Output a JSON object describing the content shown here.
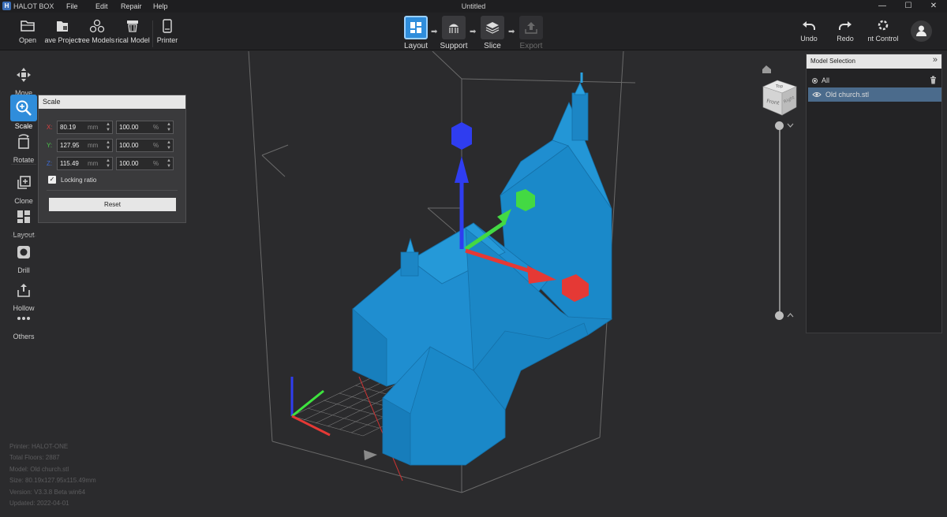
{
  "app": {
    "name": "HALOT BOX",
    "logo": "H",
    "document_title": "Untitled"
  },
  "menu": [
    "File",
    "Edit",
    "Repair",
    "Help"
  ],
  "window_controls": {
    "minimize": "—",
    "maximize": "☐",
    "close": "✕"
  },
  "toolbar_left": [
    {
      "label": "Open",
      "icon": "folder-open-icon"
    },
    {
      "label": "ave Project",
      "icon": "save-project-icon"
    },
    {
      "label": "ree Models",
      "icon": "free-models-icon"
    },
    {
      "label": "rical Model",
      "icon": "historical-model-icon"
    },
    {
      "label": "Printer",
      "icon": "printer-icon"
    }
  ],
  "steps": [
    {
      "label": "Layout",
      "state": "active",
      "icon": "layout-icon"
    },
    {
      "label": "Support",
      "state": "normal",
      "icon": "support-icon"
    },
    {
      "label": "Slice",
      "state": "normal",
      "icon": "slice-icon"
    },
    {
      "label": "Export",
      "state": "disabled",
      "icon": "export-icon"
    }
  ],
  "toolbar_right": [
    {
      "label": "Undo",
      "icon": "undo-icon"
    },
    {
      "label": "Redo",
      "icon": "redo-icon"
    },
    {
      "label": "nt Control",
      "icon": "print-control-icon"
    }
  ],
  "sidebar": [
    {
      "label": "Move",
      "icon": "move-icon",
      "active": false
    },
    {
      "label": "Scale",
      "icon": "scale-icon",
      "active": true
    },
    {
      "label": "Rotate",
      "icon": "rotate-icon",
      "active": false
    },
    {
      "label": "Clone",
      "icon": "clone-icon",
      "active": false
    },
    {
      "label": "Layout",
      "icon": "layout-icon",
      "active": false
    },
    {
      "label": "Drill",
      "icon": "drill-icon",
      "active": false
    },
    {
      "label": "Hollow",
      "icon": "hollow-icon",
      "active": false
    },
    {
      "label": "Others",
      "icon": "more-icon",
      "active": false
    }
  ],
  "scale_panel": {
    "title": "Scale",
    "rows": [
      {
        "axis": "X:",
        "value": "80.19",
        "unit": "mm",
        "percent": "100.00",
        "percent_unit": "%",
        "color": "#d94040"
      },
      {
        "axis": "Y:",
        "value": "127.95",
        "unit": "mm",
        "percent": "100.00",
        "percent_unit": "%",
        "color": "#49c44a"
      },
      {
        "axis": "Z:",
        "value": "115.49",
        "unit": "mm",
        "percent": "100.00",
        "percent_unit": "%",
        "color": "#3b6bd6"
      }
    ],
    "locking_ratio_label": "Locking ratio",
    "locking_ratio_checked": true,
    "reset_label": "Reset"
  },
  "model_selection": {
    "title": "Model Selection",
    "items": [
      {
        "label": "All",
        "selected": false
      },
      {
        "label": "Old church.stl",
        "selected": true
      }
    ]
  },
  "view_cube": {
    "top": "Top",
    "front": "Front",
    "right": "Right"
  },
  "info": [
    "Printer: HALOT-ONE",
    "Total Floors: 2887",
    "Model: Old church.stl",
    "Size: 80.19x127.95x115.49mm",
    "Version: V3.3.8 Beta win64",
    "Updated:  2022-04-01"
  ],
  "colors": {
    "accent": "#2f8ddb",
    "model": "#1f8fd0",
    "axis_x": "#e53935",
    "axis_y": "#43d943",
    "axis_z": "#2f3df0"
  }
}
